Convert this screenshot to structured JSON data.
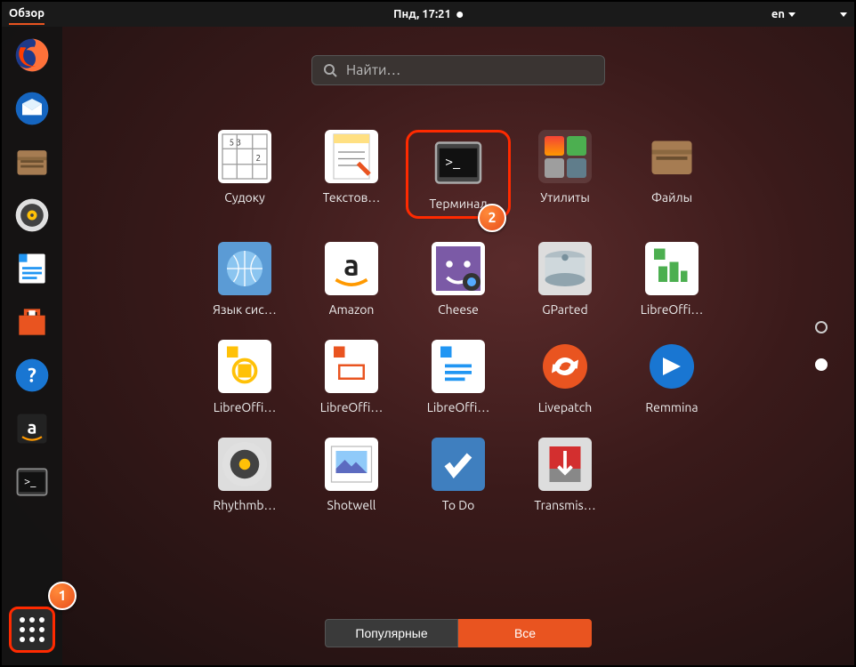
{
  "topbar": {
    "activities": "Обзор",
    "datetime": "Пнд, 17:21",
    "lang": "en"
  },
  "search": {
    "placeholder": "Найти…"
  },
  "dockApps": [
    "firefox",
    "thunderbird",
    "files",
    "rhythmbox",
    "writer",
    "software",
    "help",
    "amazon",
    "terminal"
  ],
  "apps": [
    {
      "label": "Судоку",
      "icon": "sudoku"
    },
    {
      "label": "Текстов…",
      "icon": "texteditor"
    },
    {
      "label": "Терминал",
      "icon": "terminal",
      "highlight": true
    },
    {
      "label": "Утилиты",
      "icon": "utilities-folder"
    },
    {
      "label": "Файлы",
      "icon": "files"
    },
    {
      "label": "Язык сис…",
      "icon": "language"
    },
    {
      "label": "Amazon",
      "icon": "amazon"
    },
    {
      "label": "Cheese",
      "icon": "cheese"
    },
    {
      "label": "GParted",
      "icon": "gparted"
    },
    {
      "label": "LibreOffi…",
      "icon": "calc"
    },
    {
      "label": "LibreOffi…",
      "icon": "draw"
    },
    {
      "label": "LibreOffi…",
      "icon": "impress"
    },
    {
      "label": "LibreOffi…",
      "icon": "writer"
    },
    {
      "label": "Livepatch",
      "icon": "livepatch"
    },
    {
      "label": "Remmina",
      "icon": "remmina"
    },
    {
      "label": "Rhythmb…",
      "icon": "rhythmbox"
    },
    {
      "label": "Shotwell",
      "icon": "shotwell"
    },
    {
      "label": "To Do",
      "icon": "todo"
    },
    {
      "label": "Transmis…",
      "icon": "transmission"
    }
  ],
  "tabs": {
    "frequent": "Популярные",
    "all": "Все"
  },
  "annotations": {
    "step1": "1",
    "step2": "2"
  }
}
